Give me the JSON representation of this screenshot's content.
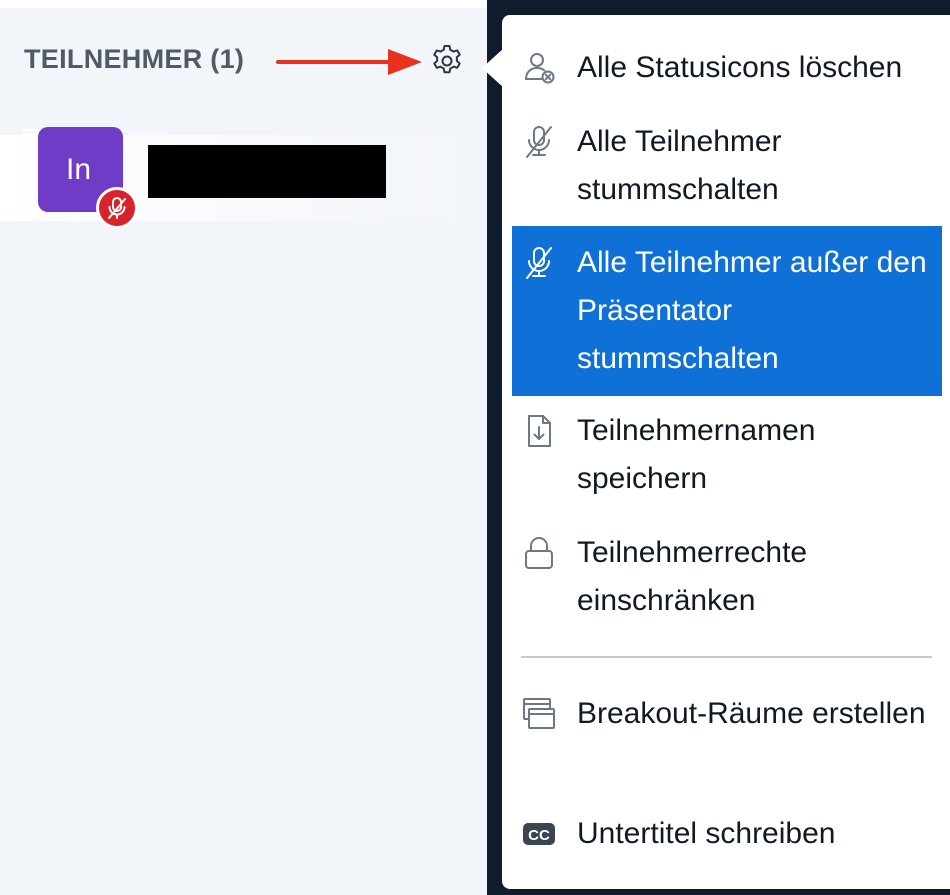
{
  "participants_panel": {
    "title": "TEILNEHMER (1)",
    "participants": [
      {
        "initials": "In",
        "avatar_color": "#6f3cc8",
        "status_icon": "muted-mic-icon",
        "name_redacted": true
      }
    ]
  },
  "colors": {
    "panel_bg": "#f2f5f9",
    "active_item": "#0f70d7",
    "mute_badge": "#d8232a",
    "annotation_arrow": "#e8321e"
  },
  "menu": {
    "items": [
      {
        "label": "Alle Statusicons löschen",
        "icon": "clear-status-icon"
      },
      {
        "label": "Alle Teilnehmer stummschalten",
        "icon": "muted-mic-icon"
      },
      {
        "label": "Alle Teilnehmer außer den Präsentator stummschalten",
        "icon": "muted-mic-icon",
        "active": true
      },
      {
        "label": "Teilnehmernamen speichern",
        "icon": "file-download-icon"
      },
      {
        "label": "Teilnehmerrechte einschränken",
        "icon": "lock-icon"
      },
      {
        "label": "Breakout-Räume erstellen",
        "icon": "breakout-rooms-icon"
      },
      {
        "label": "Untertitel schreiben",
        "icon": "closed-captions-icon",
        "icon_text": "CC"
      }
    ]
  }
}
